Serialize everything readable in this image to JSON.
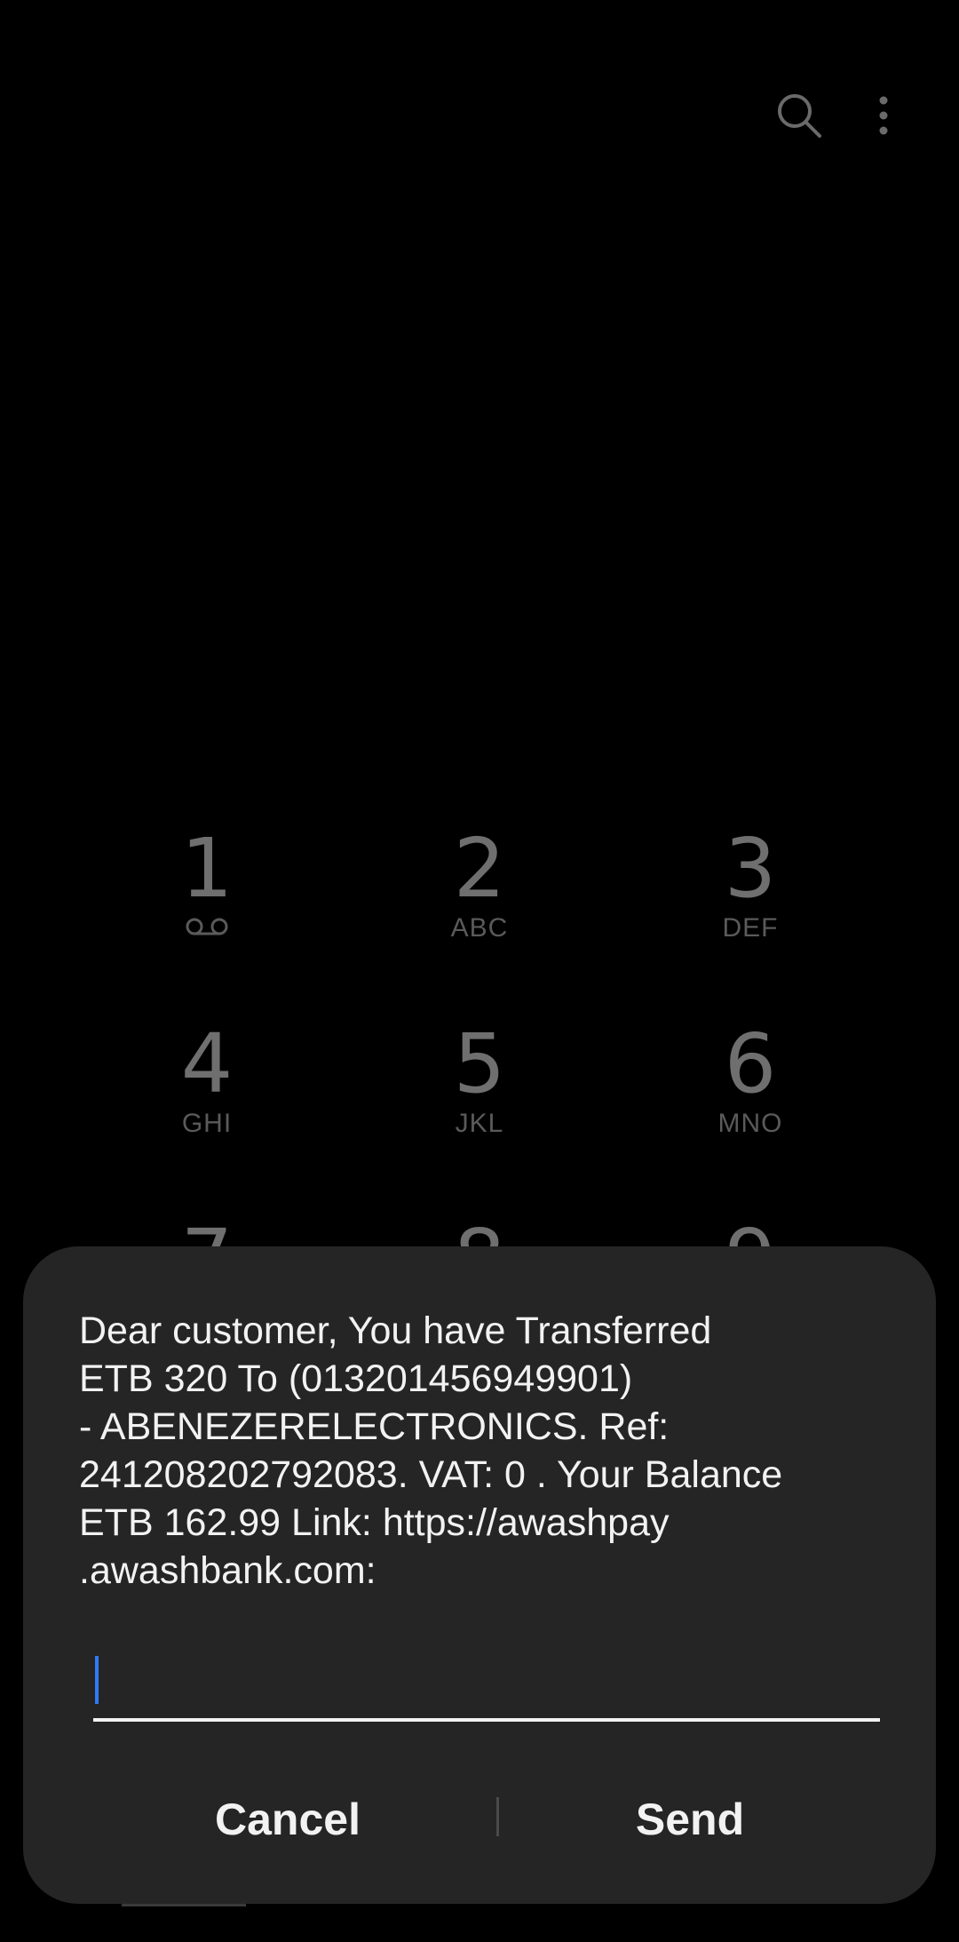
{
  "header": {
    "search_icon": "search-icon",
    "more_icon": "more-vert-icon"
  },
  "keypad": {
    "keys": [
      {
        "digit": "1",
        "letters": ""
      },
      {
        "digit": "2",
        "letters": "ABC"
      },
      {
        "digit": "3",
        "letters": "DEF"
      },
      {
        "digit": "4",
        "letters": "GHI"
      },
      {
        "digit": "5",
        "letters": "JKL"
      },
      {
        "digit": "6",
        "letters": "MNO"
      },
      {
        "digit": "7",
        "letters": ""
      },
      {
        "digit": "8",
        "letters": ""
      },
      {
        "digit": "9",
        "letters": ""
      }
    ]
  },
  "dialog": {
    "message": "Dear customer, You have Transferred\nETB 320 To (013201456949901)\n- ABENEZERELECTRONICS. Ref:\n241208202792083.  VAT: 0 . Your Balance\nETB 162.99 Link: https://awashpay\n.awashbank.com:",
    "input_value": "",
    "cancel_label": "Cancel",
    "send_label": "Send"
  },
  "colors": {
    "background": "#000000",
    "dialog": "#252525",
    "caret": "#2f7bf5",
    "key_digit": "#6f6f6f"
  }
}
